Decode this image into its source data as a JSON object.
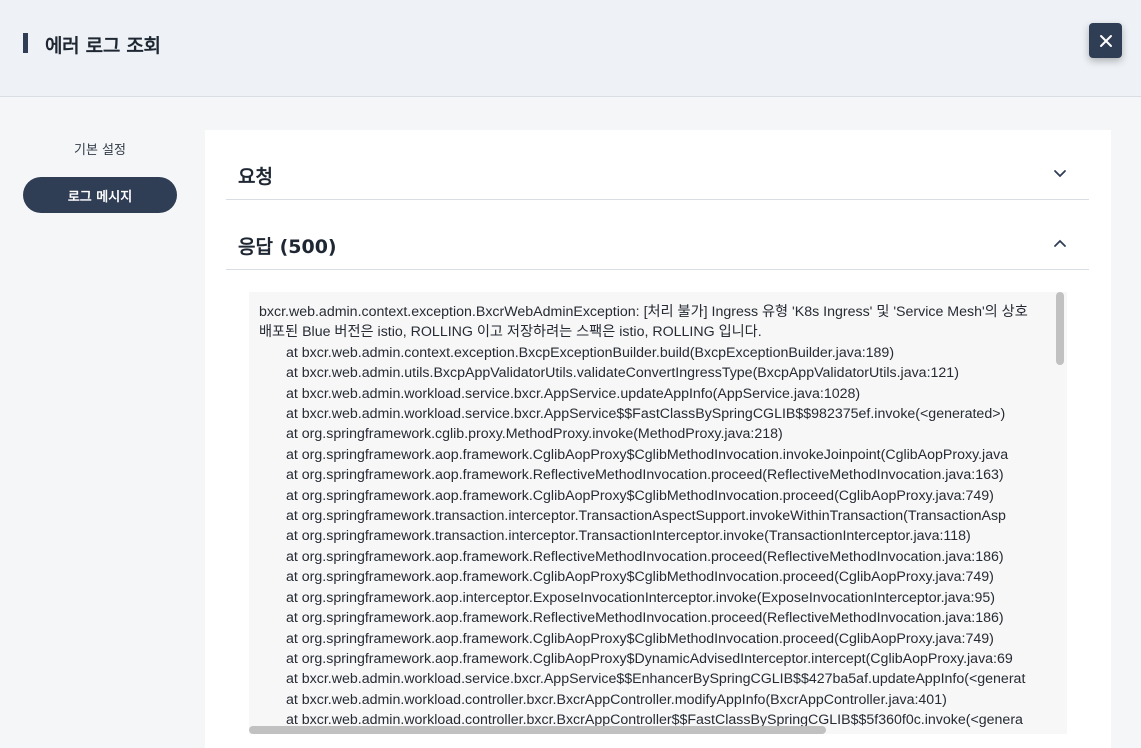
{
  "header": {
    "title": "에러 로그 조회",
    "close_icon": "close-icon"
  },
  "sidebar": {
    "items": [
      {
        "label": "기본 설정",
        "active": false
      },
      {
        "label": "로그 메시지",
        "active": true
      }
    ]
  },
  "sections": {
    "request": {
      "title": "요청",
      "icon": "chevron-down-icon"
    },
    "response": {
      "title": "응답 (500)",
      "icon": "chevron-up-icon"
    }
  },
  "log": {
    "lines": [
      "bxcr.web.admin.context.exception.BxcrWebAdminException: [처리 불가] Ingress 유형 'K8s Ingress' 및 'Service Mesh'의 상호",
      "배포된 Blue 버전은 istio, ROLLING 이고 저장하려는 스팩은 istio, ROLLING 입니다.",
      "at bxcr.web.admin.context.exception.BxcpExceptionBuilder.build(BxcpExceptionBuilder.java:189)",
      "at bxcr.web.admin.utils.BxcpAppValidatorUtils.validateConvertIngressType(BxcpAppValidatorUtils.java:121)",
      "at bxcr.web.admin.workload.service.bxcr.AppService.updateAppInfo(AppService.java:1028)",
      "at bxcr.web.admin.workload.service.bxcr.AppService$$FastClassBySpringCGLIB$$982375ef.invoke(<generated>)",
      "at org.springframework.cglib.proxy.MethodProxy.invoke(MethodProxy.java:218)",
      "at org.springframework.aop.framework.CglibAopProxy$CglibMethodInvocation.invokeJoinpoint(CglibAopProxy.java",
      "at org.springframework.aop.framework.ReflectiveMethodInvocation.proceed(ReflectiveMethodInvocation.java:163)",
      "at org.springframework.aop.framework.CglibAopProxy$CglibMethodInvocation.proceed(CglibAopProxy.java:749)",
      "at org.springframework.transaction.interceptor.TransactionAspectSupport.invokeWithinTransaction(TransactionAsp",
      "at org.springframework.transaction.interceptor.TransactionInterceptor.invoke(TransactionInterceptor.java:118)",
      "at org.springframework.aop.framework.ReflectiveMethodInvocation.proceed(ReflectiveMethodInvocation.java:186)",
      "at org.springframework.aop.framework.CglibAopProxy$CglibMethodInvocation.proceed(CglibAopProxy.java:749)",
      "at org.springframework.aop.interceptor.ExposeInvocationInterceptor.invoke(ExposeInvocationInterceptor.java:95)",
      "at org.springframework.aop.framework.ReflectiveMethodInvocation.proceed(ReflectiveMethodInvocation.java:186)",
      "at org.springframework.aop.framework.CglibAopProxy$CglibMethodInvocation.proceed(CglibAopProxy.java:749)",
      "at org.springframework.aop.framework.CglibAopProxy$DynamicAdvisedInterceptor.intercept(CglibAopProxy.java:69",
      "at bxcr.web.admin.workload.service.bxcr.AppService$$EnhancerBySpringCGLIB$$427ba5af.updateAppInfo(<generat",
      "at bxcr.web.admin.workload.controller.bxcr.BxcrAppController.modifyAppInfo(BxcrAppController.java:401)",
      "at bxcr.web.admin.workload.controller.bxcr.BxcrAppController$$FastClassBySpringCGLIB$$5f360f0c.invoke(<genera"
    ]
  },
  "colors": {
    "accent": "#2f3d55",
    "header_bg": "#eef2f6",
    "log_bg": "#f7f7f7"
  }
}
